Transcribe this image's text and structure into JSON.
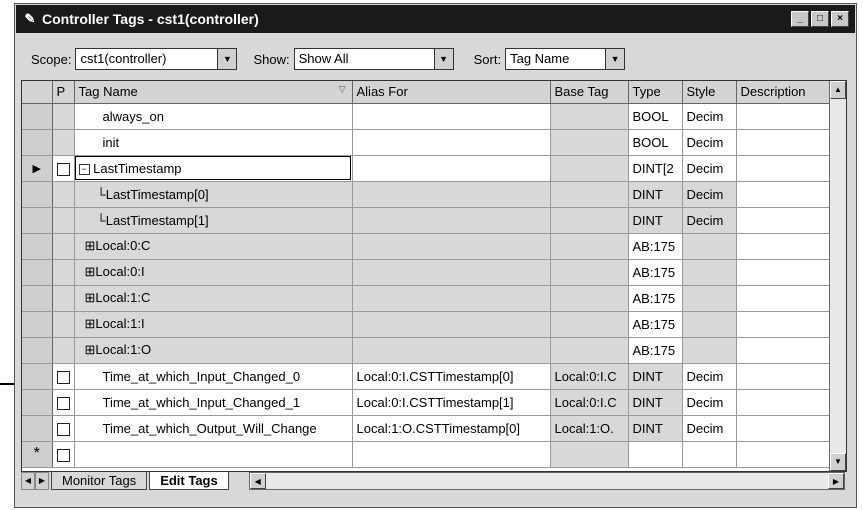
{
  "window": {
    "title": "Controller Tags - cst1(controller)",
    "min": "_",
    "max": "□",
    "close": "×"
  },
  "toolbar": {
    "scope_label": "Scope:",
    "scope_value": "cst1(controller)",
    "show_label": "Show:",
    "show_value": "Show All",
    "sort_label": "Sort:",
    "sort_value": "Tag Name"
  },
  "columns": [
    "P",
    "Tag Name",
    "Alias For",
    "Base Tag",
    "Type",
    "Style",
    "Description"
  ],
  "rows": [
    {
      "name": "always_on",
      "alias": "",
      "base": "",
      "type": "BOOL",
      "style": "Decim"
    },
    {
      "name": "init",
      "alias": "",
      "base": "",
      "type": "BOOL",
      "style": "Decim"
    },
    {
      "name": "LastTimestamp",
      "alias": "",
      "base": "",
      "type": "DINT[2",
      "style": "Decim"
    },
    {
      "name": "LastTimestamp[0]",
      "alias": "",
      "base": "",
      "type": "DINT",
      "style": "Decim"
    },
    {
      "name": "LastTimestamp[1]",
      "alias": "",
      "base": "",
      "type": "DINT",
      "style": "Decim"
    },
    {
      "name": "Local:0:C",
      "alias": "",
      "base": "",
      "type": "AB:175",
      "style": ""
    },
    {
      "name": "Local:0:I",
      "alias": "",
      "base": "",
      "type": "AB:175",
      "style": ""
    },
    {
      "name": "Local:1:C",
      "alias": "",
      "base": "",
      "type": "AB:175",
      "style": ""
    },
    {
      "name": "Local:1:I",
      "alias": "",
      "base": "",
      "type": "AB:175",
      "style": ""
    },
    {
      "name": "Local:1:O",
      "alias": "",
      "base": "",
      "type": "AB:175",
      "style": ""
    },
    {
      "name": "Time_at_which_Input_Changed_0",
      "alias": "Local:0:I.CSTTimestamp[0]",
      "base": "Local:0:I.C",
      "type": "DINT",
      "style": "Decim"
    },
    {
      "name": "Time_at_which_Input_Changed_1",
      "alias": "Local:0:I.CSTTimestamp[1]",
      "base": "Local:0:I.C",
      "type": "DINT",
      "style": "Decim"
    },
    {
      "name": "Time_at_which_Output_Will_Change",
      "alias": "Local:1:O.CSTTimestamp[0]",
      "base": "Local:1:O.",
      "type": "DINT",
      "style": "Decim"
    }
  ],
  "new_row_marker": "*",
  "tabs": [
    "Monitor Tags",
    "Edit Tags"
  ],
  "icons": {
    "title": "pencil-icon",
    "dropdown": "triangle-down-icon",
    "expand": "plus-box-icon",
    "collapse": "minus-box-icon"
  }
}
